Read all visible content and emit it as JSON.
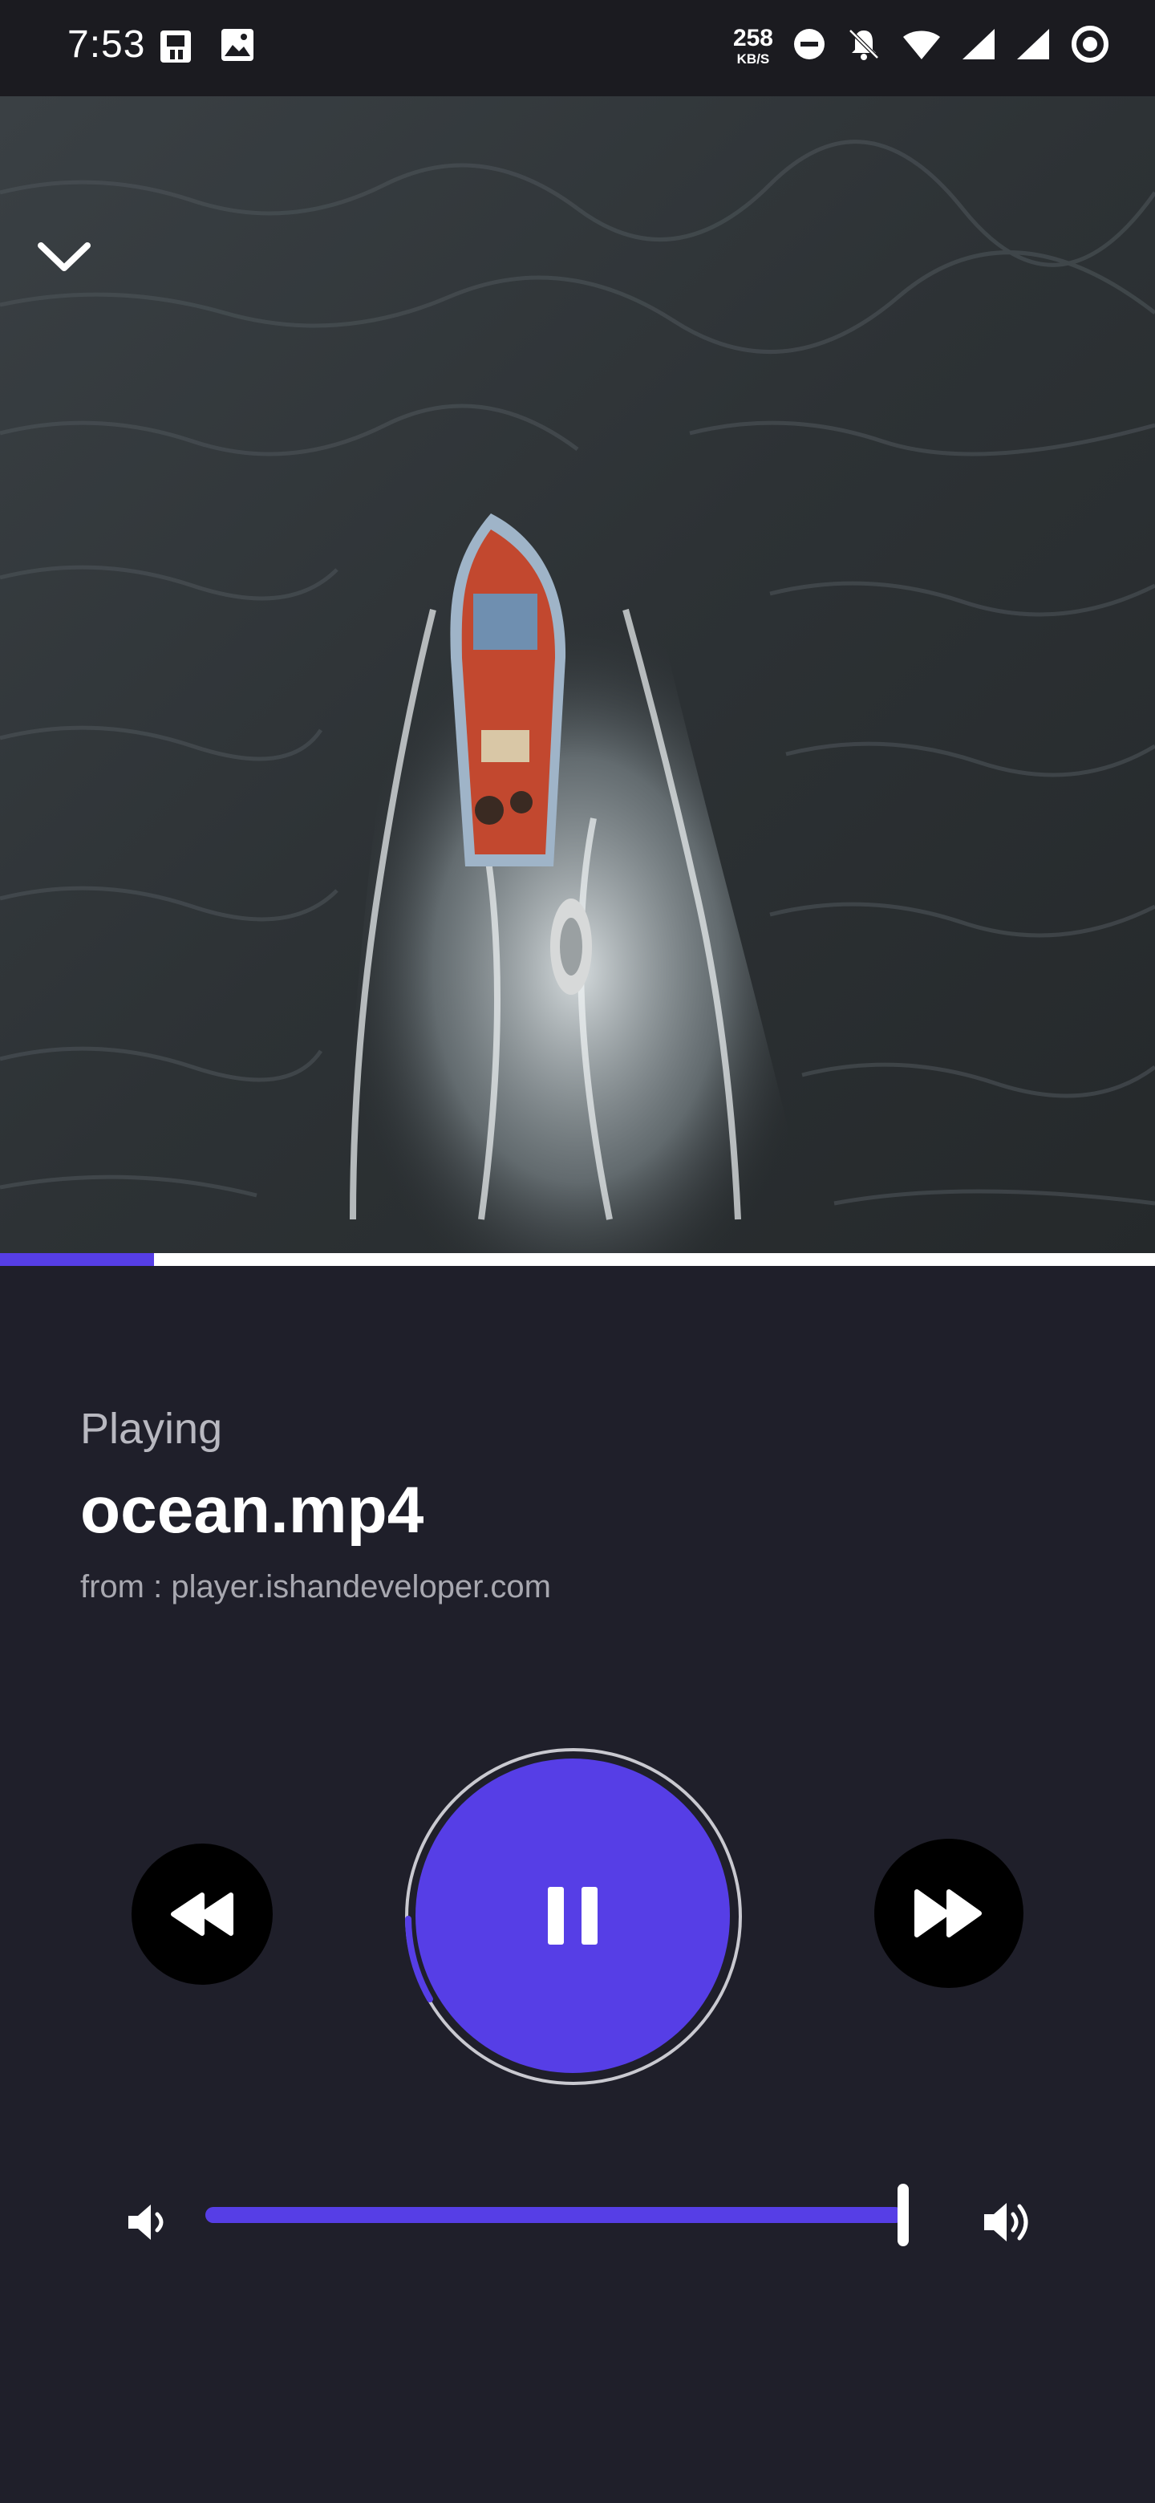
{
  "status_bar": {
    "time": "7:53",
    "network_speed_value": "258",
    "network_speed_unit": "KB/S",
    "icons": [
      "phone-sync-icon",
      "gallery-icon",
      "dnd-icon",
      "bell-off-icon",
      "wifi-icon",
      "signal-icon",
      "signal-icon-2",
      "circle-ring-icon"
    ]
  },
  "player": {
    "progress_fraction": 0.133,
    "status_label": "Playing",
    "title": "ocean.mp4",
    "source": "from : player.ishandeveloper.com",
    "accent_color": "#563ee6",
    "background_color": "#1f1f2a"
  },
  "controls": {
    "rewind_icon": "rewind-icon",
    "pause_icon": "pause-icon",
    "forward_icon": "fast-forward-icon"
  },
  "volume": {
    "level_fraction": 1.0,
    "down_icon": "volume-low-icon",
    "up_icon": "volume-high-icon"
  }
}
